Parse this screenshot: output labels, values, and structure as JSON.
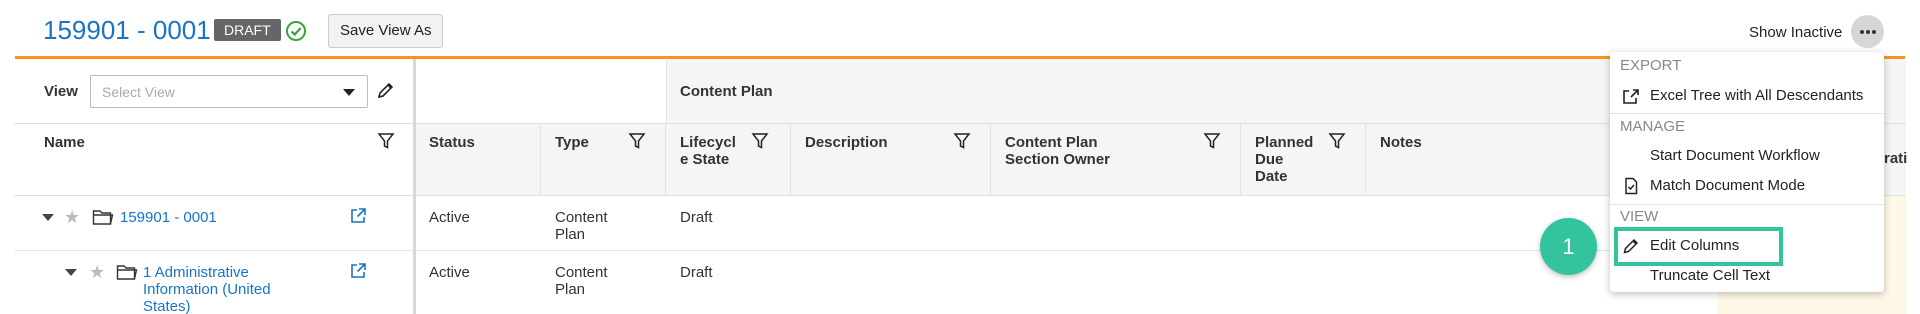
{
  "header": {
    "title": "159901 - 0001",
    "status_badge": "DRAFT",
    "save_view_label": "Save View As",
    "show_inactive_label": "Show Inactive"
  },
  "view_bar": {
    "label": "View",
    "select_placeholder": "Select View"
  },
  "table": {
    "group_header": "Content Plan",
    "columns": {
      "name": "Name",
      "status": "Status",
      "type": "Type",
      "lifecycle_1": "Lifecycl",
      "lifecycle_2": "e State",
      "description": "Description",
      "owner_1": "Content Plan",
      "owner_2": "Section Owner",
      "due_1": "Planned",
      "due_2": "Due",
      "due_3": "Date",
      "notes": "Notes",
      "partial": "rati"
    },
    "rows": [
      {
        "name": "159901 - 0001",
        "status": "Active",
        "type_1": "Content",
        "type_2": "Plan",
        "state": "Draft"
      },
      {
        "name_1": "1 Administrative",
        "name_2": "Information (United",
        "name_3": "States)",
        "status": "Active",
        "type_1": "Content",
        "type_2": "Plan",
        "state": "Draft"
      }
    ]
  },
  "menu": {
    "export_header": "EXPORT",
    "export_items": [
      "Excel Tree with All Descendants"
    ],
    "manage_header": "MANAGE",
    "manage_items": [
      "Start Document Workflow",
      "Match Document Mode"
    ],
    "view_header": "VIEW",
    "view_items": [
      "Edit Columns",
      "Truncate Cell Text"
    ]
  },
  "callout": {
    "number": "1"
  },
  "colors": {
    "accent_link": "#1a73c8",
    "orange_rule": "#f7931e",
    "callout": "#33c49e",
    "badge_bg": "#666666"
  }
}
